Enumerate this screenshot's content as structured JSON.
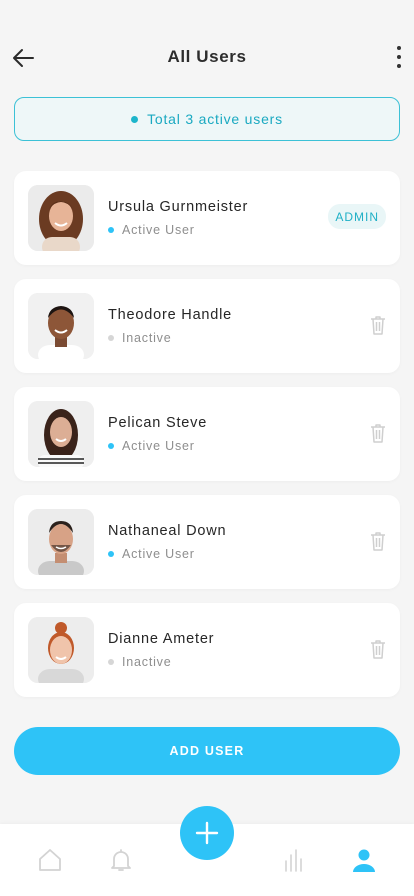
{
  "header": {
    "title": "All Users"
  },
  "summary": {
    "text": "Total 3 active users"
  },
  "users": [
    {
      "name": "Ursula Gurnmeister",
      "status": "Active User",
      "badge": "ADMIN"
    },
    {
      "name": "Theodore Handle",
      "status": "Inactive"
    },
    {
      "name": "Pelican Steve",
      "status": "Active User"
    },
    {
      "name": "Nathaneal Down",
      "status": "Active User"
    },
    {
      "name": "Dianne Ameter",
      "status": "Inactive"
    }
  ],
  "actions": {
    "add_user_label": "ADD USER"
  },
  "colors": {
    "accent": "#2ec3f7",
    "active_dot": "#2ec3f7",
    "inactive_dot": "#d6d6d6",
    "teal_text": "#1aa9c1"
  },
  "icons": {
    "back": "arrow-left-icon",
    "more": "more-vertical-icon",
    "trash": "trash-icon",
    "home": "home-icon",
    "bell": "bell-icon",
    "add": "plus-icon",
    "stats": "bar-chart-icon",
    "profile": "user-icon"
  }
}
